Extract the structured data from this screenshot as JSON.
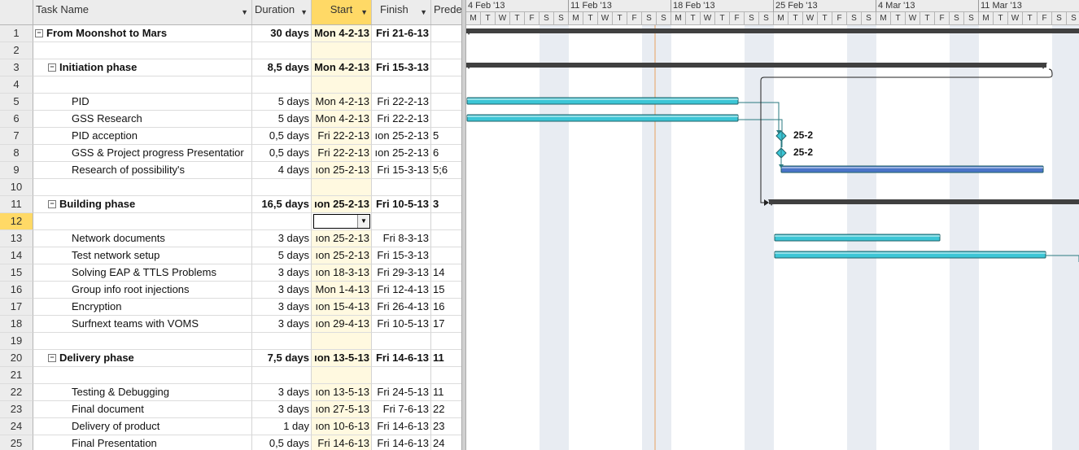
{
  "columns": {
    "task_name": "Task Name",
    "duration": "Duration",
    "start": "Start",
    "finish": "Finish",
    "predecessors": "Predec"
  },
  "rows": [
    {
      "id": "1",
      "name": "From Moonshot to Mars",
      "duration": "30 days",
      "start": "Mon 4-2-13",
      "finish": "Fri 21-6-13",
      "pred": "",
      "bold": true,
      "summary": true,
      "level": 0
    },
    {
      "id": "2",
      "name": "",
      "duration": "",
      "start": "",
      "finish": "",
      "pred": "",
      "level": 0
    },
    {
      "id": "3",
      "name": "Initiation phase",
      "duration": "8,5 days",
      "start": "Mon 4-2-13",
      "finish": "Fri 15-3-13",
      "pred": "",
      "bold": true,
      "summary": true,
      "level": 1
    },
    {
      "id": "4",
      "name": "",
      "duration": "",
      "start": "",
      "finish": "",
      "pred": "",
      "level": 0
    },
    {
      "id": "5",
      "name": "PID",
      "duration": "5 days",
      "start": "Mon 4-2-13",
      "finish": "Fri 22-2-13",
      "pred": "",
      "level": 2
    },
    {
      "id": "6",
      "name": "GSS Research",
      "duration": "5 days",
      "start": "Mon 4-2-13",
      "finish": "Fri 22-2-13",
      "pred": "",
      "level": 2
    },
    {
      "id": "7",
      "name": "PID acception",
      "duration": "0,5 days",
      "start": "Fri 22-2-13",
      "finish": "ıon 25-2-13",
      "pred": "5",
      "level": 2
    },
    {
      "id": "8",
      "name": "GSS & Project progress Presentatior",
      "duration": "0,5 days",
      "start": "Fri 22-2-13",
      "finish": "ıon 25-2-13",
      "pred": "6",
      "level": 2
    },
    {
      "id": "9",
      "name": "Research of possibility's",
      "duration": "4 days",
      "start": "ıon 25-2-13",
      "finish": "Fri 15-3-13",
      "pred": "5;6",
      "level": 2
    },
    {
      "id": "10",
      "name": "",
      "duration": "",
      "start": "",
      "finish": "",
      "pred": "",
      "level": 0
    },
    {
      "id": "11",
      "name": "Building phase",
      "duration": "16,5 days",
      "start": "ıon 25-2-13",
      "finish": "Fri 10-5-13",
      "pred": "3",
      "bold": true,
      "summary": true,
      "level": 1
    },
    {
      "id": "12",
      "name": "",
      "duration": "",
      "start": "",
      "finish": "",
      "pred": "",
      "level": 0,
      "active": true
    },
    {
      "id": "13",
      "name": "Network documents",
      "duration": "3 days",
      "start": "ıon 25-2-13",
      "finish": "Fri 8-3-13",
      "pred": "",
      "level": 2
    },
    {
      "id": "14",
      "name": "Test network setup",
      "duration": "5 days",
      "start": "ıon 25-2-13",
      "finish": "Fri 15-3-13",
      "pred": "",
      "level": 2
    },
    {
      "id": "15",
      "name": "Solving EAP & TTLS Problems",
      "duration": "3 days",
      "start": "ıon 18-3-13",
      "finish": "Fri 29-3-13",
      "pred": "14",
      "level": 2
    },
    {
      "id": "16",
      "name": "Group info root injections",
      "duration": "3 days",
      "start": "Mon 1-4-13",
      "finish": "Fri 12-4-13",
      "pred": "15",
      "level": 2
    },
    {
      "id": "17",
      "name": "Encryption",
      "duration": "3 days",
      "start": "ıon 15-4-13",
      "finish": "Fri 26-4-13",
      "pred": "16",
      "level": 2
    },
    {
      "id": "18",
      "name": "Surfnext teams with VOMS",
      "duration": "3 days",
      "start": "ıon 29-4-13",
      "finish": "Fri 10-5-13",
      "pred": "17",
      "level": 2
    },
    {
      "id": "19",
      "name": "",
      "duration": "",
      "start": "",
      "finish": "",
      "pred": "",
      "level": 0
    },
    {
      "id": "20",
      "name": "Delivery phase",
      "duration": "7,5 days",
      "start": "ıon 13-5-13",
      "finish": "Fri 14-6-13",
      "pred": "11",
      "bold": true,
      "summary": true,
      "level": 1
    },
    {
      "id": "21",
      "name": "",
      "duration": "",
      "start": "",
      "finish": "",
      "pred": "",
      "level": 0
    },
    {
      "id": "22",
      "name": "Testing & Debugging",
      "duration": "3 days",
      "start": "ıon 13-5-13",
      "finish": "Fri 24-5-13",
      "pred": "11",
      "level": 2
    },
    {
      "id": "23",
      "name": "Final document",
      "duration": "3 days",
      "start": "ıon 27-5-13",
      "finish": "Fri 7-6-13",
      "pred": "22",
      "level": 2
    },
    {
      "id": "24",
      "name": "Delivery of product",
      "duration": "1 day",
      "start": "ıon 10-6-13",
      "finish": "Fri 14-6-13",
      "pred": "23",
      "level": 2
    },
    {
      "id": "25",
      "name": "Final Presentation",
      "duration": "0,5 days",
      "start": "Fri 14-6-13",
      "finish": "Fri 14-6-13",
      "pred": "24",
      "level": 2
    }
  ],
  "timescale": {
    "weeks": [
      "4 Feb '13",
      "11 Feb '13",
      "18 Feb '13",
      "25 Feb '13",
      "4 Mar '13",
      "11 Mar '13"
    ],
    "day_letters": [
      "M",
      "T",
      "W",
      "T",
      "F",
      "S",
      "S"
    ]
  },
  "gantt": {
    "milestones": [
      {
        "row": "7",
        "label": "25-2"
      },
      {
        "row": "8",
        "label": "25-2"
      }
    ],
    "colors": {
      "summary_bar": "#404040",
      "task_bar": "#3cc6d6",
      "critical_task_bar": "#4a74c8",
      "milestone": "#3cc6d6",
      "today_line": "#e8a060",
      "link_line": "#2a7a80",
      "active_column": "#ffd966"
    }
  }
}
